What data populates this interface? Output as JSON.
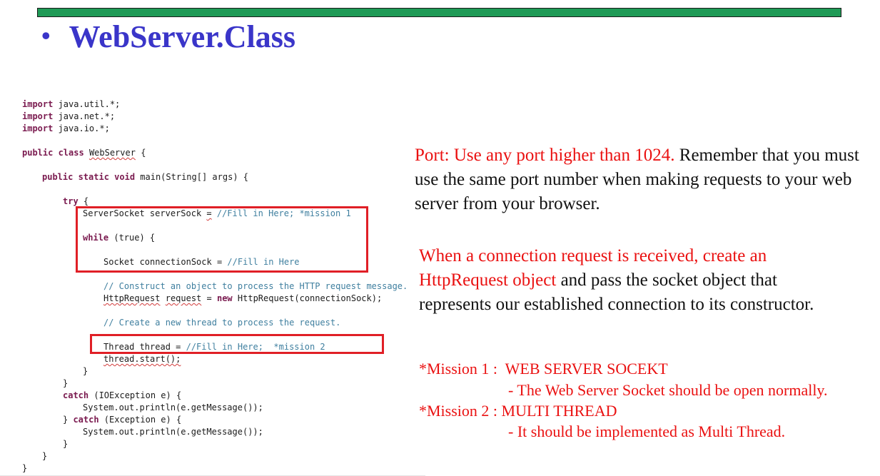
{
  "slide": {
    "title": "WebServer.Class",
    "bullet": "•"
  },
  "code": {
    "l1_kw": "import",
    "l1_rest": " java.util.*;",
    "l2_kw": "import",
    "l2_rest": " java.net.*;",
    "l3_kw": "import",
    "l3_rest": " java.io.*;",
    "l4_kw": "public class",
    "l4_name": "WebServer",
    "l4_rest": " {",
    "l5_kw": "public static void",
    "l5_rest": " main(String[] args) {",
    "l6_kw": "try",
    "l6_rest": " {",
    "l7_a": "ServerSocket serverSock ",
    "l7_eq": "=",
    "l7_cm": " //Fill in Here; *mission 1",
    "l8_kw": "while",
    "l8_rest": " (true) {",
    "l9_a": "Socket connectionSock = ",
    "l9_cm": "//Fill in Here",
    "l10_cm": "// Construct an object to process the HTTP request message.",
    "l11_a": "HttpRequest",
    "l11_b": " ",
    "l11_c": "request",
    "l11_d": " = ",
    "l11_kw": "new",
    "l11_e": " HttpRequest(connectionSock);",
    "l12_cm": "// Create a new thread to process the request.",
    "l13_a": "Thread thread = ",
    "l13_cm": "//Fill in Here;  *mission 2",
    "l14_a": "thread.start();",
    "l15_a": "}",
    "l16_a": "}",
    "l17_kw": "catch",
    "l17_rest": " (IOException e) {",
    "l18_a": "System.out.println(e.getMessage());",
    "l19_a": "} ",
    "l19_kw": "catch",
    "l19_rest": " (Exception e) {",
    "l20_a": "System.out.println(e.getMessage());",
    "l21_a": "}",
    "l22_a": "}",
    "l23_a": "}"
  },
  "port_note": {
    "red_part": "Port: Use any port higher than 1024.",
    "black_part": " Remember that you must use the same port number when making requests to your web server from your browser."
  },
  "connection_note": {
    "red_part": "When a connection request is received, create an HttpRequest object",
    "black_part": " and pass the socket object that represents our established connection to its constructor."
  },
  "missions": {
    "m1": "*Mission 1 :  WEB SERVER SOCEKT",
    "m1_detail": "- The Web Server Socket should be open normally.",
    "m2": "*Mission 2 : MULTI THREAD",
    "m2_detail": "- It should be implemented as Multi Thread."
  }
}
